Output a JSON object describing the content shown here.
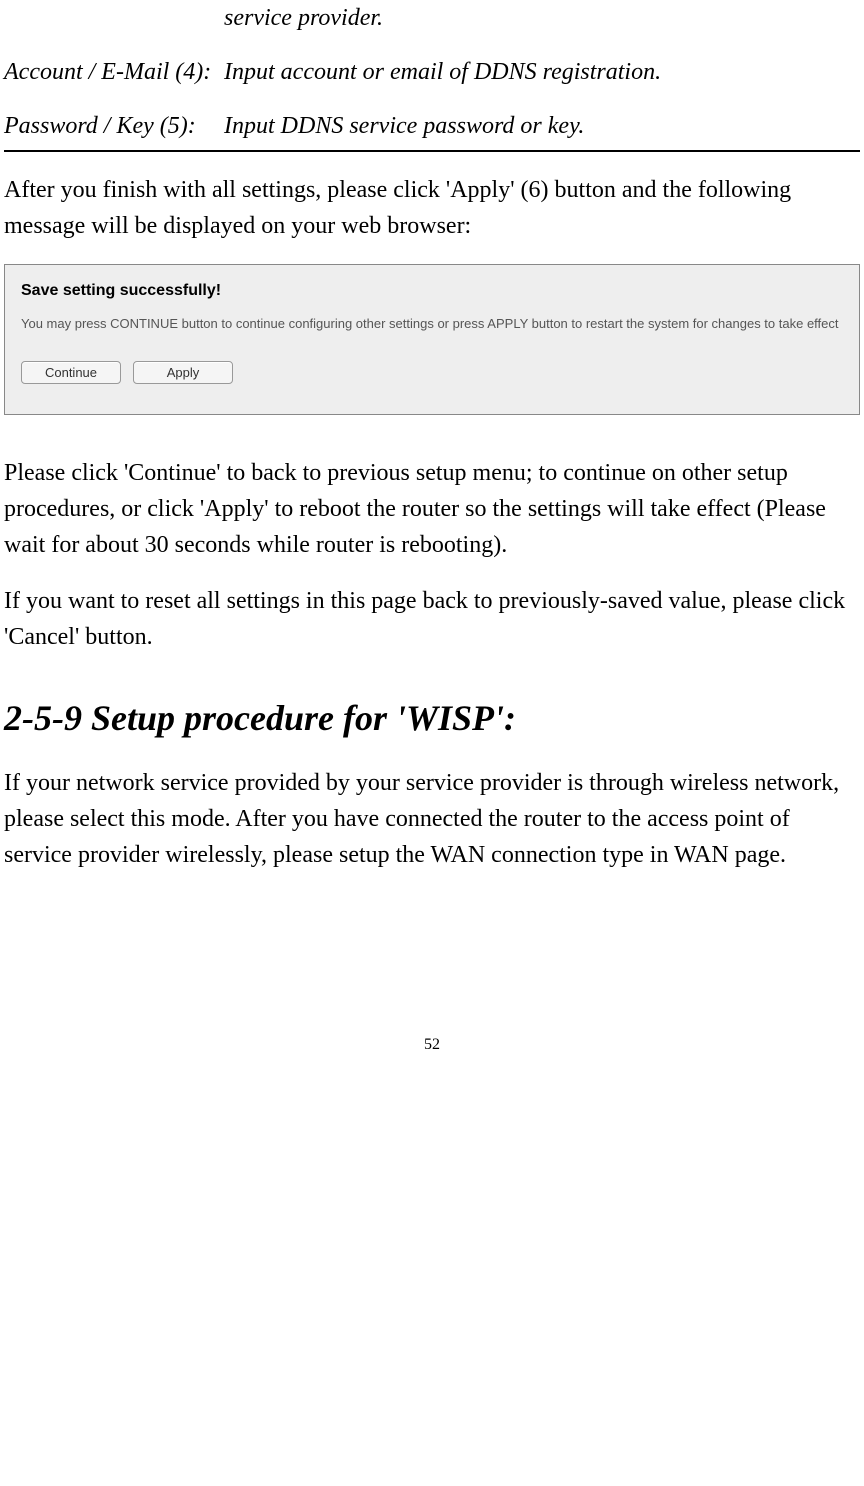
{
  "table": {
    "row0_desc_partial": "service provider.",
    "row1_label": "Account / E-Mail (4):",
    "row1_desc": "Input account or email of DDNS registration.",
    "row2_label": "Password / Key (5):",
    "row2_desc": "Input DDNS service password or key."
  },
  "para1": "After you finish with all settings, please click 'Apply' (6) button and the following message will be displayed on your web browser:",
  "screenshot": {
    "title": "Save setting successfully!",
    "text": "You may press CONTINUE button to continue configuring other settings or press APPLY button to restart the system for changes to take effect",
    "continue_btn": "Continue",
    "apply_btn": "Apply"
  },
  "para2": "Please click 'Continue' to back to previous setup menu; to continue on other setup procedures, or click 'Apply' to reboot the router so the settings will take effect (Please wait for about 30 seconds while router is rebooting).",
  "para3": "If you want to reset all settings in this page back to previously-saved value, please click 'Cancel' button.",
  "heading": "2-5-9 Setup procedure for 'WISP':",
  "para4": "If your network service provided by your service provider is through wireless network, please select this mode. After you have connected the router to the access point of service provider wirelessly, please setup the WAN connection type in WAN page.",
  "page_number": "52"
}
